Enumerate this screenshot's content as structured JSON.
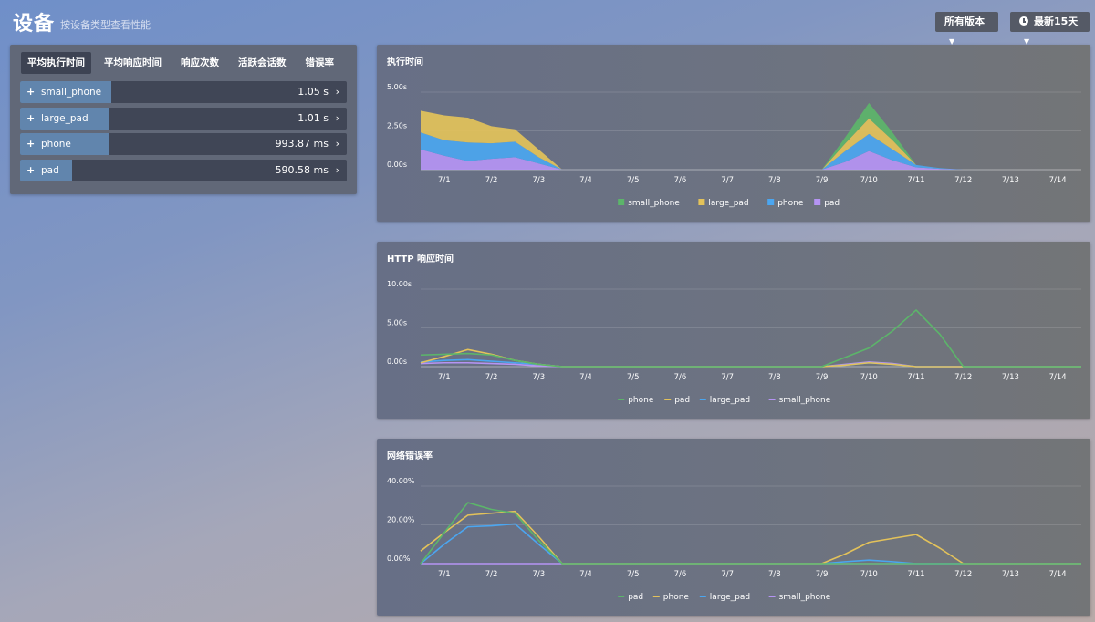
{
  "header": {
    "title": "设备",
    "subtitle": "按设备类型查看性能",
    "version_label": "所有版本",
    "range_label": "最新15天",
    "icons": [
      "clock-icon",
      "caret-down-icon"
    ]
  },
  "device_panel": {
    "tabs": [
      "平均执行时间",
      "平均响应时间",
      "响应次数",
      "活跃会话数",
      "错误率"
    ],
    "active_tab": 0,
    "rows": [
      {
        "name": "small_phone",
        "value": "1.05 s",
        "fraction": 0.28
      },
      {
        "name": "large_pad",
        "value": "1.01 s",
        "fraction": 0.27
      },
      {
        "name": "phone",
        "value": "993.87 ms",
        "fraction": 0.27
      },
      {
        "name": "pad",
        "value": "590.58 ms",
        "fraction": 0.16
      }
    ],
    "plus_symbol": "+",
    "chevron_symbol": "›"
  },
  "colors": {
    "green": "#5cb56a",
    "yellow": "#e3c25a",
    "blue": "#4ba6f0",
    "purple": "#b594f4"
  },
  "chart_data": [
    {
      "type": "area",
      "title": "执行时间",
      "x": [
        "",
        "7/1",
        "",
        "7/2",
        "",
        "7/3",
        "",
        "7/4",
        "",
        "7/5",
        "",
        "7/6",
        "",
        "7/7",
        "",
        "7/8",
        "",
        "7/9",
        "",
        "7/10",
        "",
        "7/11",
        "",
        "7/12",
        "",
        "7/13",
        "",
        "7/14",
        ""
      ],
      "xticks": [
        "7/1",
        "7/2",
        "7/3",
        "7/4",
        "7/5",
        "7/6",
        "7/7",
        "7/8",
        "7/9",
        "7/10",
        "7/11",
        "7/12",
        "7/13",
        "7/14"
      ],
      "yticks": [
        "0.00s",
        "2.50s",
        "5.00s"
      ],
      "ylim": [
        0,
        5
      ],
      "stacked": true,
      "series": [
        {
          "name": "pad",
          "color": "#b594f4",
          "values": [
            1.3,
            0.9,
            0.55,
            0.7,
            0.8,
            0.4,
            0,
            0,
            0,
            0,
            0,
            0,
            0,
            0,
            0,
            0,
            0,
            0,
            0.5,
            1.2,
            0.6,
            0.15,
            0.05,
            0,
            0,
            0,
            0,
            0,
            0
          ]
        },
        {
          "name": "phone",
          "color": "#4ba6f0",
          "values": [
            1.1,
            1.0,
            1.2,
            1.0,
            1.0,
            0.4,
            0,
            0,
            0,
            0,
            0,
            0,
            0,
            0,
            0,
            0,
            0,
            0,
            0.7,
            1.1,
            0.7,
            0.15,
            0.05,
            0,
            0,
            0,
            0,
            0,
            0
          ]
        },
        {
          "name": "large_pad",
          "color": "#e3c25a",
          "values": [
            1.4,
            1.6,
            1.6,
            1.1,
            0.8,
            0.5,
            0,
            0,
            0,
            0,
            0,
            0,
            0,
            0,
            0,
            0,
            0,
            0,
            0.5,
            1.0,
            0.6,
            0,
            0,
            0,
            0,
            0,
            0,
            0,
            0
          ]
        },
        {
          "name": "small_phone",
          "color": "#5cb56a",
          "values": [
            0,
            0,
            0,
            0,
            0,
            0,
            0,
            0,
            0,
            0,
            0,
            0,
            0,
            0,
            0,
            0,
            0,
            0,
            0.4,
            1.0,
            0.5,
            0,
            0,
            0,
            0,
            0,
            0,
            0,
            0
          ]
        }
      ],
      "legend": [
        {
          "name": "small_phone",
          "color": "#5cb56a"
        },
        {
          "name": "large_pad",
          "color": "#e3c25a"
        },
        {
          "name": "phone",
          "color": "#4ba6f0"
        },
        {
          "name": "pad",
          "color": "#b594f4"
        }
      ]
    },
    {
      "type": "line",
      "title": "HTTP 响应时间",
      "x": [
        "",
        "7/1",
        "",
        "7/2",
        "",
        "7/3",
        "",
        "7/4",
        "",
        "7/5",
        "",
        "7/6",
        "",
        "7/7",
        "",
        "7/8",
        "",
        "7/9",
        "",
        "7/10",
        "",
        "7/11",
        "",
        "7/12",
        "",
        "7/13",
        "",
        "7/14",
        ""
      ],
      "xticks": [
        "7/1",
        "7/2",
        "7/3",
        "7/4",
        "7/5",
        "7/6",
        "7/7",
        "7/8",
        "7/9",
        "7/10",
        "7/11",
        "7/12",
        "7/13",
        "7/14"
      ],
      "yticks": [
        "0.00s",
        "5.00s",
        "10.00s"
      ],
      "ylim": [
        0,
        10
      ],
      "series": [
        {
          "name": "phone",
          "color": "#5cb56a",
          "values": [
            1.5,
            1.6,
            1.7,
            1.5,
            0.8,
            0.3,
            0,
            0,
            0,
            0,
            0,
            0,
            0,
            0,
            0,
            0,
            0,
            0,
            1.2,
            2.4,
            4.6,
            7.3,
            4.2,
            0,
            0,
            0,
            0,
            0,
            0
          ]
        },
        {
          "name": "pad",
          "color": "#e3c25a",
          "values": [
            0.5,
            1.3,
            2.2,
            1.6,
            0.8,
            0.3,
            0,
            0,
            0,
            0,
            0,
            0,
            0,
            0,
            0,
            0,
            0,
            0,
            0.2,
            0.5,
            0.3,
            0,
            0,
            0,
            0,
            0,
            0,
            0,
            0
          ]
        },
        {
          "name": "large_pad",
          "color": "#4ba6f0",
          "values": [
            0.6,
            0.8,
            0.9,
            0.7,
            0.5,
            0.3,
            0,
            0,
            0,
            0,
            0,
            0,
            0,
            0,
            0,
            0,
            0,
            0,
            0.2,
            0.5,
            0.3,
            0,
            0,
            0,
            0,
            0,
            0,
            0,
            0
          ]
        },
        {
          "name": "small_phone",
          "color": "#b594f4",
          "values": [
            0.4,
            0.5,
            0.5,
            0.4,
            0.3,
            0.1,
            0,
            0,
            0,
            0,
            0,
            0,
            0,
            0,
            0,
            0,
            0,
            0,
            0.3,
            0.6,
            0.4,
            0,
            0,
            0,
            0,
            0,
            0,
            0,
            0
          ]
        }
      ],
      "legend": [
        {
          "name": "phone",
          "color": "#5cb56a"
        },
        {
          "name": "pad",
          "color": "#e3c25a"
        },
        {
          "name": "large_pad",
          "color": "#4ba6f0"
        },
        {
          "name": "small_phone",
          "color": "#b594f4"
        }
      ]
    },
    {
      "type": "line",
      "title": "网络错误率",
      "x": [
        "",
        "7/1",
        "",
        "7/2",
        "",
        "7/3",
        "",
        "7/4",
        "",
        "7/5",
        "",
        "7/6",
        "",
        "7/7",
        "",
        "7/8",
        "",
        "7/9",
        "",
        "7/10",
        "",
        "7/11",
        "",
        "7/12",
        "",
        "7/13",
        "",
        "7/14",
        ""
      ],
      "xticks": [
        "7/1",
        "7/2",
        "7/3",
        "7/4",
        "7/5",
        "7/6",
        "7/7",
        "7/8",
        "7/9",
        "7/10",
        "7/11",
        "7/12",
        "7/13",
        "7/14"
      ],
      "yticks": [
        "0.00%",
        "20.00%",
        "40.00%"
      ],
      "ylim": [
        0,
        40
      ],
      "series": [
        {
          "name": "pad",
          "color": "#5cb56a",
          "values": [
            0,
            16,
            31.5,
            28,
            26,
            12,
            0,
            0,
            0,
            0,
            0,
            0,
            0,
            0,
            0,
            0,
            0,
            0,
            0,
            0,
            0,
            0,
            0,
            0,
            0,
            0,
            0,
            0,
            0
          ]
        },
        {
          "name": "phone",
          "color": "#e3c25a",
          "values": [
            6.5,
            16,
            25,
            26,
            27,
            14,
            0,
            0,
            0,
            0,
            0,
            0,
            0,
            0,
            0,
            0,
            0,
            0,
            5,
            11,
            13,
            15,
            8,
            0,
            0,
            0,
            0,
            0,
            0
          ]
        },
        {
          "name": "large_pad",
          "color": "#4ba6f0",
          "values": [
            0,
            10,
            19,
            19.5,
            20.5,
            10,
            0,
            0,
            0,
            0,
            0,
            0,
            0,
            0,
            0,
            0,
            0,
            0,
            1,
            1.8,
            1,
            0,
            0,
            0,
            0,
            0,
            0,
            0,
            0
          ]
        },
        {
          "name": "small_phone",
          "color": "#b594f4",
          "values": [
            0,
            0,
            0,
            0,
            0,
            0,
            0,
            0,
            0,
            0,
            0,
            0,
            0,
            0,
            0,
            0,
            0,
            0,
            0,
            0,
            0,
            0,
            0,
            0,
            0,
            0,
            0,
            0,
            0
          ]
        }
      ],
      "legend": [
        {
          "name": "pad",
          "color": "#5cb56a"
        },
        {
          "name": "phone",
          "color": "#e3c25a"
        },
        {
          "name": "large_pad",
          "color": "#4ba6f0"
        },
        {
          "name": "small_phone",
          "color": "#b594f4"
        }
      ]
    }
  ]
}
